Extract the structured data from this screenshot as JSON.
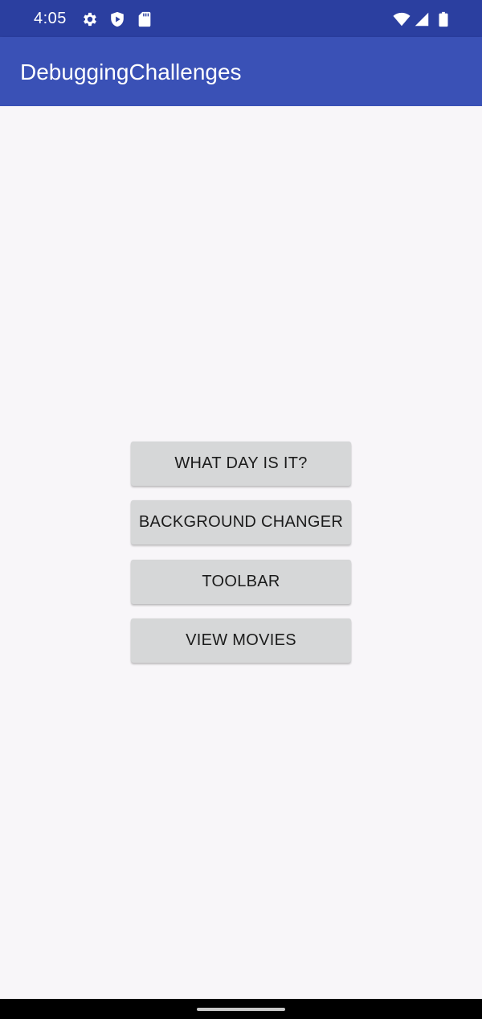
{
  "status_bar": {
    "time": "4:05",
    "left_icons": [
      "gear-icon",
      "play-shield-icon",
      "sd-card-icon"
    ],
    "right_icons": [
      "wifi-icon",
      "cellular-signal-icon",
      "battery-icon"
    ],
    "color": "#2b3fa0"
  },
  "app_bar": {
    "title": "DebuggingChallenges",
    "color": "#3a51b6"
  },
  "main": {
    "buttons": [
      {
        "label": "WHAT DAY IS IT?"
      },
      {
        "label": "BACKGROUND CHANGER"
      },
      {
        "label": "TOOLBAR"
      },
      {
        "label": "VIEW MOVIES"
      }
    ]
  },
  "nav_bar": {
    "handle": "gesture-handle"
  }
}
